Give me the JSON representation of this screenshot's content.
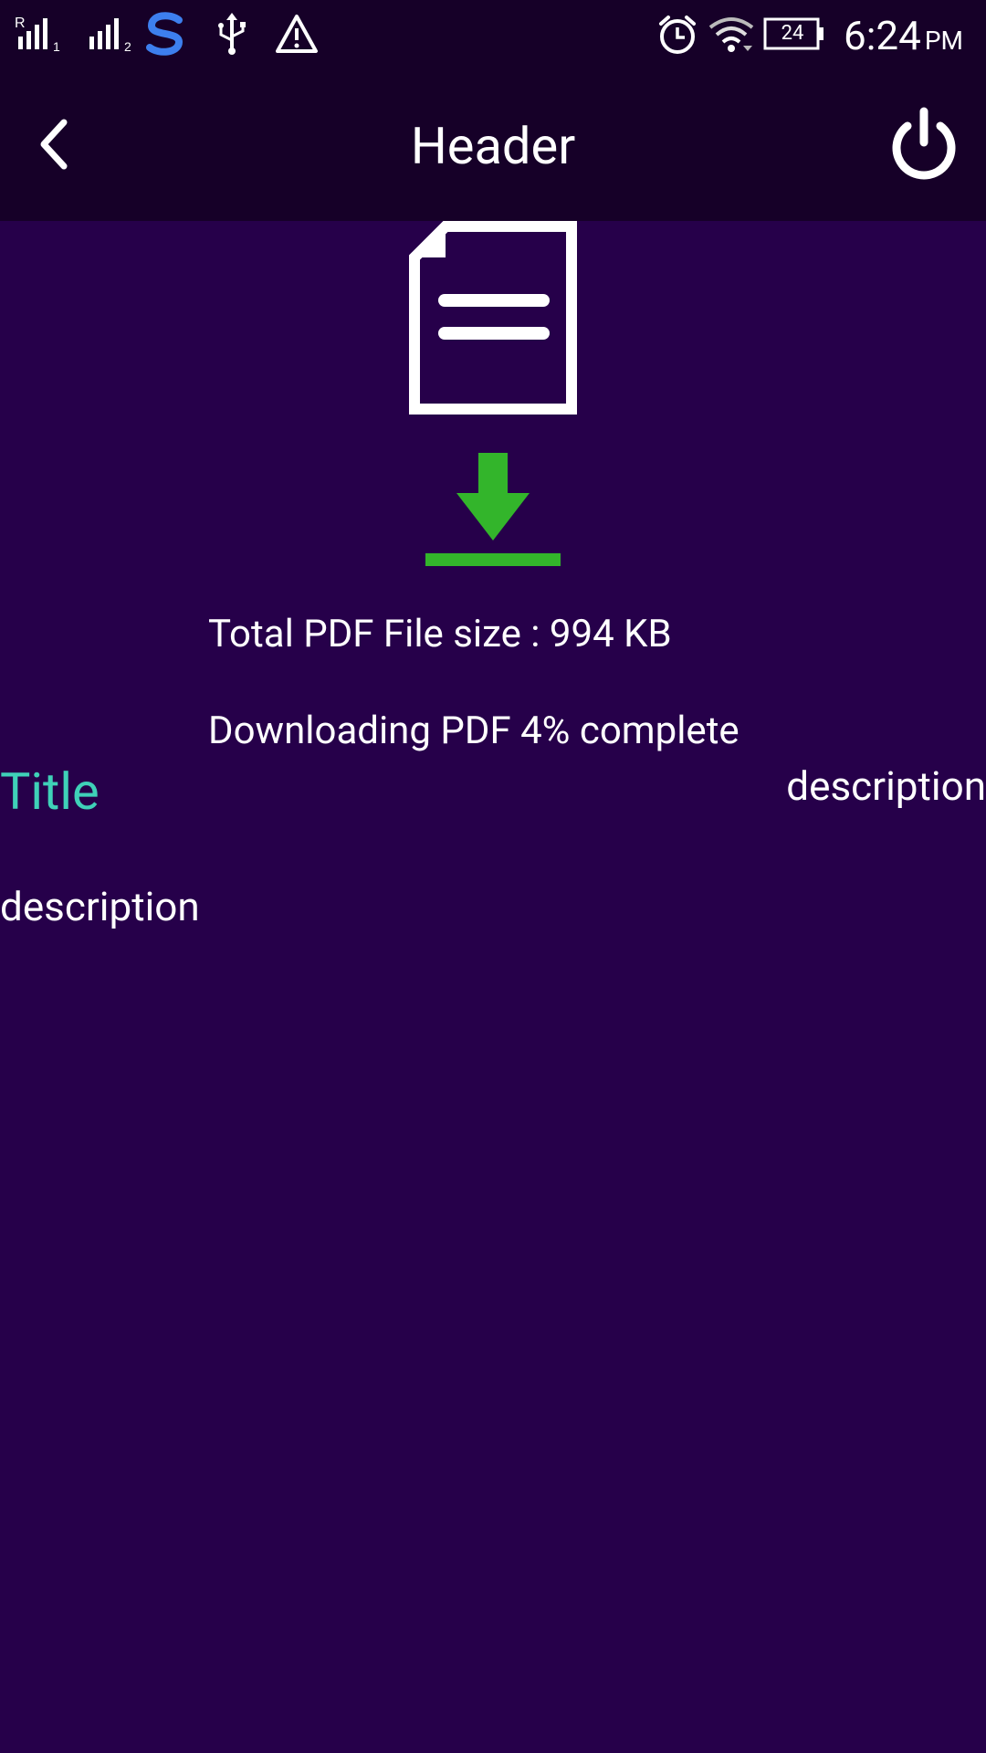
{
  "status_bar": {
    "time": "6:24",
    "ampm": "PM",
    "battery_level": "24",
    "icons": [
      "signal-roaming-icon",
      "signal-sim2-icon",
      "app-s-icon",
      "usb-icon",
      "warning-icon",
      "alarm-icon",
      "wifi-icon",
      "battery-icon"
    ]
  },
  "header": {
    "title": "Header",
    "back_icon": "chevron-left-icon",
    "power_icon": "power-icon"
  },
  "download": {
    "file_icon": "document-icon",
    "download_icon": "download-arrow-icon",
    "file_size_text": "Total PDF File size  : 994 KB",
    "progress_text": "Downloading PDF 4% complete",
    "progress_percent": 4
  },
  "item": {
    "title": "Title",
    "description_right": "description",
    "description_left": "description"
  },
  "colors": {
    "background": "#26004a",
    "bars": "#160028",
    "title_accent": "#3fd1b8",
    "download_green": "#33b52b",
    "s_app_blue": "#3d7fee"
  }
}
